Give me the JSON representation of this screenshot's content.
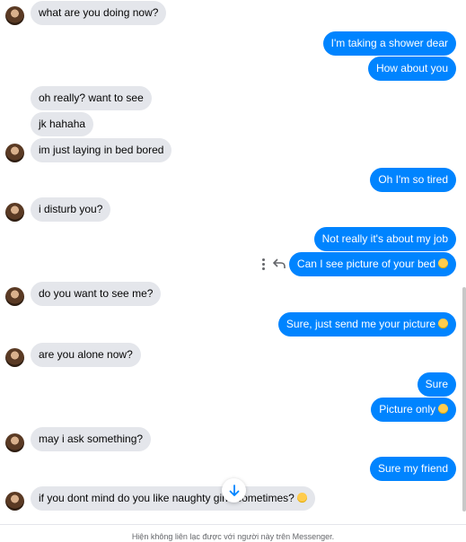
{
  "colors": {
    "incoming": "#e4e6eb",
    "outgoing": "#0084ff",
    "footer_text": "#65676b"
  },
  "messages": [
    {
      "side": "in",
      "text": "what are you doing now?",
      "emoji": ""
    },
    {
      "side": "out",
      "text": "I'm taking a shower dear",
      "emoji": ""
    },
    {
      "side": "out",
      "text": "How about you",
      "emoji": ""
    },
    {
      "side": "in",
      "text": "oh really? want to see",
      "emoji": ""
    },
    {
      "side": "in",
      "text": "jk hahaha",
      "emoji": ""
    },
    {
      "side": "in",
      "text": "im just laying in bed bored",
      "emoji": ""
    },
    {
      "side": "out",
      "text": "Oh I'm so tired",
      "emoji": ""
    },
    {
      "side": "in",
      "text": "i disturb you?",
      "emoji": ""
    },
    {
      "side": "out",
      "text": "Not really it's about my job",
      "emoji": ""
    },
    {
      "side": "out",
      "text": "Can I see picture of your bed",
      "emoji": "thinking-face-emoji"
    },
    {
      "side": "in",
      "text": "do you want to see me?",
      "emoji": ""
    },
    {
      "side": "out",
      "text": "Sure, just send me your picture",
      "emoji": "smiling-face-emoji"
    },
    {
      "side": "in",
      "text": "are you alone now?",
      "emoji": ""
    },
    {
      "side": "out",
      "text": "Sure",
      "emoji": ""
    },
    {
      "side": "out",
      "text": "Picture only",
      "emoji": "grinning-face-emoji"
    },
    {
      "side": "in",
      "text": "may i ask something?",
      "emoji": ""
    },
    {
      "side": "out",
      "text": "Sure my friend",
      "emoji": ""
    },
    {
      "side": "in",
      "text": "if you dont mind do you like naughty girls sometimes?",
      "emoji": "grinning-face-emoji"
    }
  ],
  "message_tools": [
    "more-options-icon",
    "reply-icon"
  ],
  "scroll_button_icon": "arrow-down-icon",
  "footer": {
    "text": "Hiện không liên lạc được với người này trên Messenger."
  }
}
